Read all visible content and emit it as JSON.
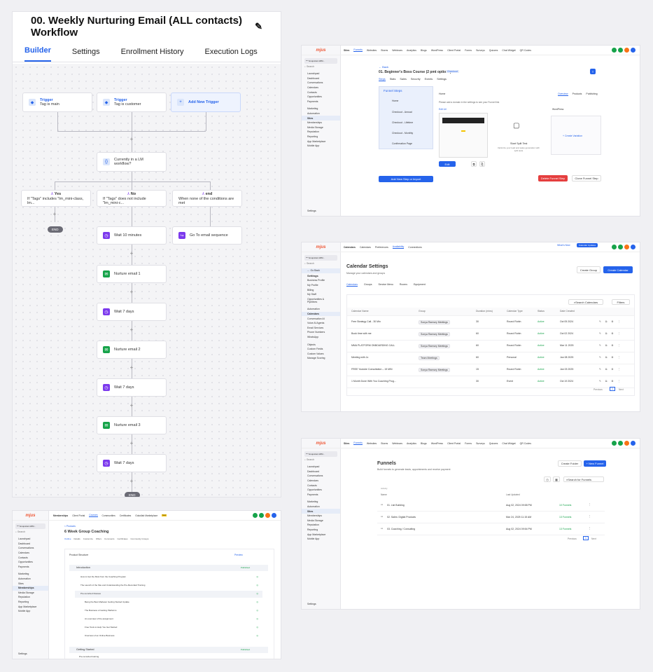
{
  "workflow": {
    "title": "00. Weekly Nurturing Email (ALL contacts) Workflow",
    "tabs": [
      "Builder",
      "Settings",
      "Enrollment History",
      "Execution Logs"
    ],
    "trigger1": {
      "label": "Trigger",
      "sub": "Tag is main"
    },
    "trigger2": {
      "label": "Trigger",
      "sub": "Tag is customer"
    },
    "add_trigger": "Add New Trigger",
    "condition": "Currently in a LM workflow?",
    "branch_yes": {
      "label": "Yes",
      "sub": "If \"Tags\" includes \"lm_mini-class, lm..."
    },
    "branch_no": {
      "label": "No",
      "sub": "If \"Tags\" does not include \"lm_mini-c..."
    },
    "branch_end": {
      "label": "end",
      "sub": "When none of the conditions are met"
    },
    "end": "END",
    "wait1": "Wait 10 minutes",
    "goto": "Go To email sequence",
    "steps": [
      "Nurture email 1",
      "Wait 7 days",
      "Nurture email 2",
      "Wait 7 days",
      "Nurture email 3",
      "Wait 7 days"
    ]
  },
  "sidebar": {
    "logo": "mjus",
    "account": "*** Exquisitel ARM...",
    "search": "Search",
    "search_key": "⌘K",
    "items": [
      "Launchpad",
      "Dashboard",
      "Conversations",
      "Calendars",
      "Contacts",
      "Opportunities",
      "Payments",
      "",
      "Marketing",
      "Automation",
      "Sites",
      "Memberships",
      "Media Storage",
      "Reputation",
      "Reporting",
      "App Marketplace",
      "Mobile App"
    ],
    "settings": "Settings"
  },
  "funnel_steps": {
    "topnav": [
      "Sites",
      "Funnels",
      "Websites",
      "Stores",
      "Webinars",
      "Analytics",
      "Blogs",
      "WordPress",
      "Client Portal",
      "Forms",
      "Surveys",
      "Quizzes",
      "Chat Widget",
      "QR Codes"
    ],
    "back": "Back",
    "title": "01. Beginner's Boss Course (2 pmt options)",
    "badge": "Checkout",
    "subtabs": [
      "Steps",
      "Stats",
      "Sales",
      "Security",
      "Events",
      "Settings"
    ],
    "panel_title": "Funnel Steps",
    "steps": [
      "Home",
      "Checkout - Annual",
      "Checkout - Lifetime",
      "Checkout - Monthly",
      "Confirmation Page"
    ],
    "add_step": "Add New Step or Import",
    "crumb": "Home",
    "tabs": [
      "Overview",
      "Products",
      "Publishing"
    ],
    "domain_note": "Please add a domain in the settings to see your Funnel link",
    "edit_btn": "Edit",
    "split_title": "Start Split Test",
    "split_sub": "Optimize your lead and sales generation with split tests",
    "create_variation": "+ Create Variation",
    "delete_btn": "Delete Funnel Step",
    "clone_btn": "Clone Funnel Step",
    "url_label": "Edit Url",
    "wp_label": "WordPress"
  },
  "calendar": {
    "topnav": [
      "Calendars",
      "Calendars",
      "Preferences",
      "Availability",
      "Connections"
    ],
    "whats_new": "What's New",
    "cal_updates": "Calendar Updates",
    "back": "Go Back",
    "settings_label": "Settings",
    "title": "Calendar Settings",
    "subtitle": "Manage your calendars and groups",
    "create_group": "Create Group",
    "create_cal": "Create Calendar",
    "tabs": [
      "Calendars",
      "Groups",
      "Service Menu",
      "Rooms",
      "Equipment"
    ],
    "search": "Search Calendars",
    "filters": "Filters",
    "cols": [
      "Calendar Name",
      "Group",
      "Duration (mins)",
      "Calendar Type",
      "Status",
      "Date Created"
    ],
    "rows": [
      [
        "Free Strategy Call - 30 Min",
        "Sonya Ramsey Meetings",
        "30",
        "Round Robin",
        "Active",
        "Oct 05 2024"
      ],
      [
        "Book time with me",
        "Sonya Ramsey Meetings",
        "60",
        "Round Robin",
        "Active",
        "Oct 02 2024"
      ],
      [
        "MMA PLATFORM ONBOARDING CALL",
        "Sonya Ramsey Meetings",
        "60",
        "Round Robin",
        "Active",
        "Mar 11 2025"
      ],
      [
        "Meeting with Jo",
        "Team Meetings",
        "60",
        "Personal",
        "Active",
        "Jan 08 2025"
      ],
      [
        "FREE Youtube Consultation – 15 MIN",
        "Sonya Ramsey Meetings",
        "15",
        "Round Robin",
        "Active",
        "Jan 03 2025"
      ],
      [
        "1 Month Done With You Coaching Prog...",
        "",
        "30",
        "Event",
        "Active",
        "Oct 19 2024"
      ]
    ],
    "previous": "Previous",
    "page": "1",
    "next": "Next",
    "side_items": [
      "Business Profile",
      "My Profile",
      "Billing",
      "My Staff",
      "Opportunities & Pipelines",
      "",
      "Automation",
      "Calendars",
      "Conversation AI",
      "Voice AI Agents",
      "Email Services",
      "Phone Numbers",
      "WhatsApp",
      "",
      "Objects",
      "Custom Fields",
      "Custom Values",
      "Manage Scoring"
    ]
  },
  "funnels": {
    "title": "Funnels",
    "subtitle": "Build funnels to generate leads, appointments and receive payment",
    "create_folder": "Create Folder",
    "new_funnel": "+ New Funnel",
    "search": "Search for Funnels",
    "cols": [
      "Name",
      "Last Updated"
    ],
    "rows": [
      [
        "01. List Building",
        "Aug 02, 2024 09:58 PM",
        "10 Funnels"
      ],
      [
        "02. Sales: Digital Products",
        "Mar 24, 2025 11:15 AM",
        "13 Funnels"
      ],
      [
        "03. Coaching / Consulting",
        "Aug 02, 2024 09:54 PM",
        "13 Funnels"
      ]
    ],
    "folder_label": "Activity",
    "previous": "Previous",
    "page": "1",
    "next": "Next"
  },
  "membership": {
    "topnav": [
      "Memberships",
      "Client Portal",
      "Courses",
      "Communities",
      "Certificates",
      "Gokollab Marketplace"
    ],
    "new": "New",
    "back": "< Products",
    "title": "6 Week Group Coaching",
    "subtabs": [
      "Outline",
      "Details",
      "Customize",
      "Offers",
      "Comments",
      "Certificates",
      "Community Groups"
    ],
    "section": "Product Structure",
    "preview": "Preview",
    "mod1": "Introduction",
    "mod2": "Getting Started",
    "lessons": [
      "How to Get the Most from the Coaching Program",
      "The Launch of the Site and Understanding the Pre-Recorded Training",
      "Pre-recorded Classes",
      "Being the Best Marketer Getting Started Update",
      "The Business of Getting Platforms",
      "An overview of the assignment",
      "Free Tools to Help You Get Started",
      "Overview of an Online Business"
    ],
    "lesson2": "Pre-recorded training",
    "published": "Published"
  },
  "colors": {
    "accent": "#2563eb",
    "green": "#16a34a",
    "purple": "#7c3aed",
    "red": "#e53e3e"
  }
}
